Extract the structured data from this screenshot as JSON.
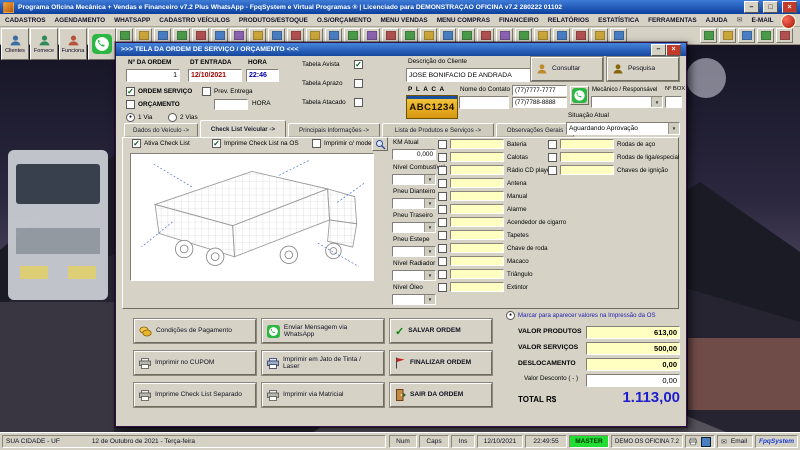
{
  "colors": {
    "accent_blue": "#1f1fcf",
    "master_green": "#22dd33",
    "whatsapp_green": "#2bb741",
    "plate_yellow": "#e8b32e",
    "field_yellow": "#ffffc2"
  },
  "icons": [
    "wrench-icon",
    "envelope-icon",
    "person-icon",
    "whatsapp-icon",
    "magnifier-icon",
    "coins-icon",
    "printer-icon",
    "flag-icon",
    "door-icon",
    "check-icon",
    "chevron-down-icon"
  ],
  "titlebar": {
    "title": "Programa Oficina Mecânica + Vendas e Financeiro v7.2 Plus WhatsApp  -  FpqSystem e Virtual Programas ®  |  Licenciado para  DEMONSTRAÇÃO OFICINA v7.2 280222 01102",
    "min": "–",
    "max": "□",
    "close": "×"
  },
  "menubar": {
    "items": [
      "CADASTROS",
      "AGENDAMENTO",
      "WHATSAPP",
      "CADASTRO VEÍCULOS",
      "PRODUTOS/ESTOQUE",
      "O.S/ORÇAMENTO",
      "MENU VENDAS",
      "MENU COMPRAS",
      "FINANCEIRO",
      "RELATÓRIOS",
      "ESTATÍSTICA",
      "FERRAMENTAS",
      "AJUDA",
      "E-MAIL"
    ]
  },
  "shortcuts": {
    "clientes": "Clientes",
    "fornece": "Fornece",
    "funciona": "Funciona"
  },
  "window": {
    "title": ">>>  TELA DA ORDEM DE SERVIÇO / ORÇAMENTO  <<<",
    "min": "–",
    "close": "×",
    "header": {
      "ordem_label": "Nº DA ORDEM",
      "ordem_value": "1",
      "dt_label": "DT ENTRADA",
      "dt_value": "12/10/2021",
      "hora_label": "HORA",
      "hora_value": "22:46",
      "ordem_servico": "ORDEM SERVIÇO",
      "orcamento": "ORÇAMENTO",
      "prev_entrega": "Prev. Entrega",
      "prev_hora_label": "HORA",
      "via1": "1 Via",
      "via2": "2 Vias",
      "tabela_avista": "Tabela Avista",
      "tabela_aprazo": "Tabela Aprazo",
      "tabela_atacado": "Tabela Atacado",
      "cliente_label": "Descrição do Cliente",
      "cliente_value": "JOSE BONIFACIO DE ANDRADA",
      "placa_label": "P L A C A",
      "placa_value": "ABC1234",
      "contato_label": "Nome do Contato",
      "phone1": "(77)7777-7777",
      "phone2": "(77)7788-8888",
      "mecanico_label": "Mecânico / Responsável",
      "box_label": "Nº BOX",
      "consultar": "Consultar",
      "pesquisa": "Pesquisa",
      "checks": {
        "ordem_servico": "✓",
        "orcamento": "",
        "prev_entrega": "",
        "tabela_avista": "✓",
        "tabela_aprazo": "",
        "tabela_atacado": "",
        "via1": "●",
        "via2": ""
      }
    },
    "tabs": [
      {
        "label": "Dados do Veículo ->"
      },
      {
        "label": "Check List Veicular ->"
      },
      {
        "label": "Principais Informações ->"
      },
      {
        "label": "Lista de Produtos e Serviços ->"
      },
      {
        "label": "Observações Gerais"
      }
    ],
    "situacao": {
      "label": "Situação Atual",
      "value": "Aguardando Aprovação"
    },
    "checklist": {
      "opt_ativa": "Ativa Check List",
      "opt_imprime": "Imprime Check List na OS",
      "opt_modelo": "Imprimir c/ modelo",
      "checks": {
        "ativa": "✓",
        "imprime": "✓",
        "modelo": ""
      },
      "km_label": "KM Atual",
      "km_value": "0,000",
      "selects": [
        "Nível Combustível",
        "Pneu Dianteiro",
        "Pneu Traseiro",
        "Pneu Estepe",
        "Nível Radiador",
        "Nível Óleo"
      ],
      "col1": [
        "Bateria",
        "Calotas",
        "Rádio CD player",
        "Antena",
        "Manual",
        "Alarme",
        "Acendedor de cigarro",
        "Tapetes",
        "Chave de roda",
        "Macaco",
        "Triângulo",
        "Extintor"
      ],
      "col2": [
        "Rodas de aço",
        "Rodas de liga/especial",
        "Chaves de ignição"
      ]
    },
    "actions": {
      "condicoes": "Condições de Pagamento",
      "whatsapp": "Enviar Mensagem via WhatsApp",
      "salvar": "SALVAR ORDEM",
      "cupom": "Imprimir no CUPOM",
      "jato": "Imprimir em Jato de Tinta / Laser",
      "finalizar": "FINALIZAR ORDEM",
      "checklist_sep": "Imprime Check List Separado",
      "matricial": "Imprimir via Matricial",
      "sair": "SAIR DA ORDEM"
    },
    "totals": {
      "marcar": "Marcar para aparecer valores na Impressão da OS",
      "marcar_state": "●",
      "produtos_label": "VALOR PRODUTOS",
      "produtos_value": "613,00",
      "servicos_label": "VALOR SERVIÇOS",
      "servicos_value": "500,00",
      "desloc_label": "DESLOCAMENTO",
      "desloc_value": "0,00",
      "desconto_label": "Valor Desconto ( - )",
      "desconto_value": "0,00",
      "total_label": "TOTAL R$",
      "total_value": "1.113,00"
    }
  },
  "statusbar": {
    "city": "SUA CIDADE - UF",
    "date_long": "12 de Outubro de 2021 - Terça-feira",
    "num": "Num",
    "caps": "Caps",
    "ins": "Ins",
    "date": "12/10/2021",
    "time": "22:49:55",
    "master": "MASTER",
    "demo": "DEMO OS OFICINA 7.2",
    "email": "Email",
    "brand": "FpqSystem"
  }
}
